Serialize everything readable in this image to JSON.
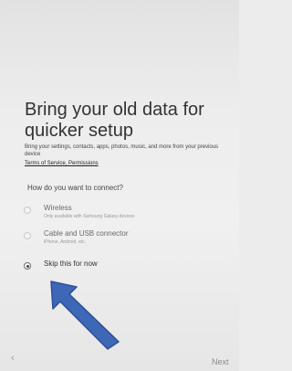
{
  "setup": {
    "title": "Bring your old data for quicker setup",
    "description": "Bring your settings, contacts, apps, photos, music, and more from your previous device",
    "links": "Terms of Service, Permissions",
    "question": "How do you want to connect?",
    "options": [
      {
        "label": "Wireless",
        "sublabel": "Only available with Samsung Galaxy devices",
        "selected": false
      },
      {
        "label": "Cable and USB connector",
        "sublabel": "iPhone, Android, etc.",
        "selected": false
      },
      {
        "label": "Skip this for now",
        "sublabel": "",
        "selected": true
      }
    ]
  },
  "nav": {
    "back_icon": "chevron-left-icon",
    "back_symbol": "‹",
    "next_label": "Next"
  },
  "annotation": {
    "icon": "arrow-icon",
    "color": "#3f67b7"
  }
}
